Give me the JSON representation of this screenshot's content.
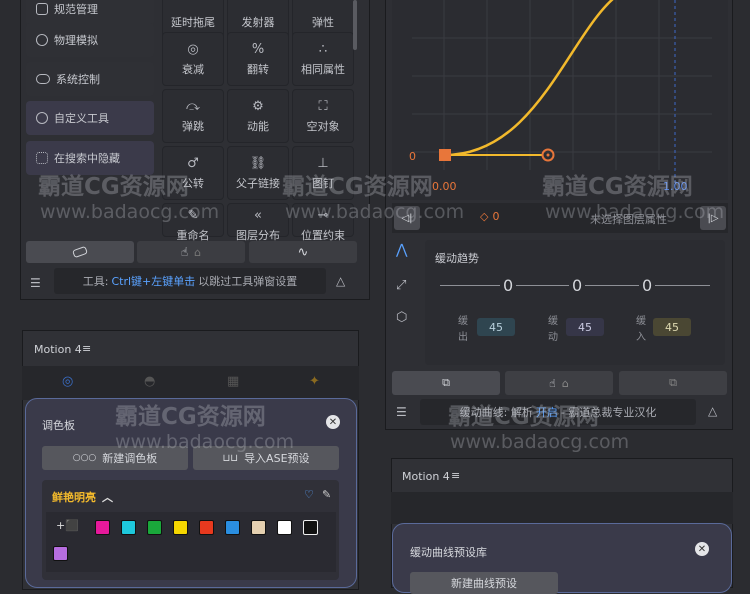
{
  "left_tools": {
    "items": [
      {
        "label": "规范管理",
        "icon": "rule-icon"
      },
      {
        "label": "物理模拟",
        "icon": "physics-icon"
      },
      {
        "label": "系统控制",
        "icon": "gamepad-icon"
      },
      {
        "label": "自定义工具",
        "icon": "heart-tool-icon"
      },
      {
        "label": "在搜索中隐藏",
        "icon": "grid-hide-icon"
      }
    ],
    "grid": [
      {
        "label": "延时拖尾",
        "glyph": ""
      },
      {
        "label": "发射器",
        "glyph": ""
      },
      {
        "label": "弹性",
        "glyph": ""
      },
      {
        "label": "衰减",
        "glyph": "◎"
      },
      {
        "label": "翻转",
        "glyph": "%"
      },
      {
        "label": "相同属性",
        "glyph": "∴"
      },
      {
        "label": "弹跳",
        "glyph": "⤼"
      },
      {
        "label": "动能",
        "glyph": "⚙"
      },
      {
        "label": "空对象",
        "glyph": "⛶"
      },
      {
        "label": "公转",
        "glyph": "♂"
      },
      {
        "label": "父子链接",
        "glyph": "⛓"
      },
      {
        "label": "图钉",
        "glyph": "⊥"
      },
      {
        "label": "重命名",
        "glyph": "✎"
      },
      {
        "label": "图层分布",
        "glyph": "«"
      },
      {
        "label": "位置约束",
        "glyph": "⊸"
      }
    ],
    "hint_prefix": "工具:",
    "hint_key": "Ctrl键+左键单击",
    "hint_suffix": "以跳过工具弹窗设置"
  },
  "curve_panel": {
    "label_zero": "0",
    "start_x": "0.00",
    "end_x": "1.00",
    "keyframe_value": "0",
    "no_layer": "未选择图层属性",
    "trend_title": "缓动趋势",
    "trend_values": [
      "0",
      "0",
      "0"
    ],
    "ease_out_label": [
      "缓",
      "出"
    ],
    "ease_label": [
      "缓",
      "动"
    ],
    "ease_in_label": [
      "缓",
      "入"
    ],
    "ease_out_value": "45",
    "ease_value": "45",
    "ease_in_value": "45",
    "status_prefix": "缓动曲线: 解析",
    "status_on": "开启",
    "status_suffix": "- 霸道总裁专业汉化",
    "curve_color": "#f2b92c"
  },
  "motion_a": {
    "title": "Motion 4",
    "popup_title": "调色板",
    "new_palette": "新建调色板",
    "import_ase": "导入ASE预设",
    "group_name": "鲜艳明亮",
    "swatches": [
      "#e6199b",
      "#1ec8dc",
      "#1aa83b",
      "#f5d600",
      "#e8391e",
      "#2a8ee0",
      "#e5d0b0",
      "#ffffff",
      "#111111",
      "#b66de0"
    ]
  },
  "motion_b": {
    "title": "Motion 4",
    "popup_title": "缓动曲线预设库",
    "button_partial": "新建曲线预设"
  },
  "watermarks": {
    "text": "霸道CG资源网",
    "url": "www.badaocg.com"
  }
}
